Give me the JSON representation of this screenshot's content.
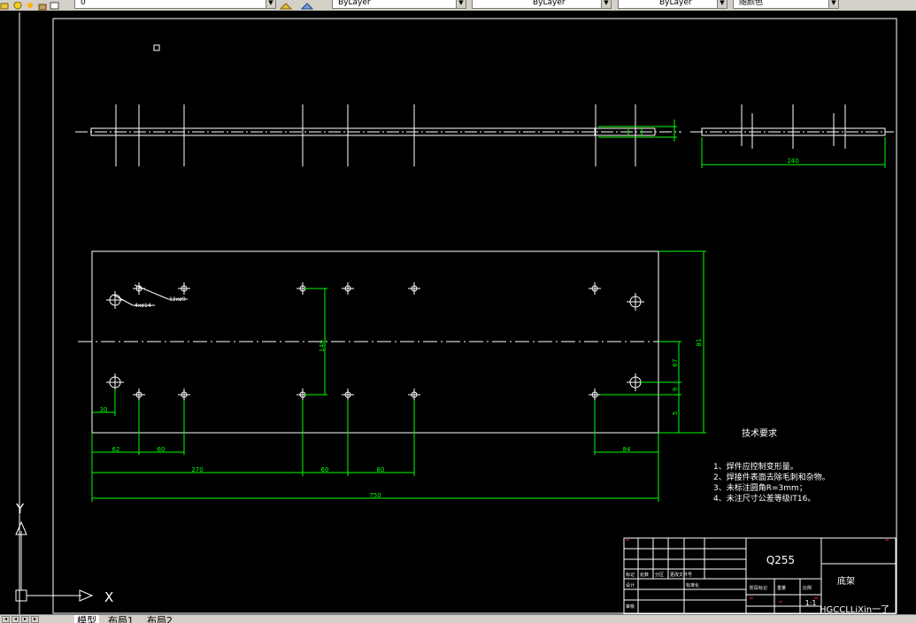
{
  "toolbar": {
    "layer_value": "0",
    "color_value": "ByLayer",
    "linetype_value": "ByLayer",
    "lineweight_value": "ByLayer",
    "plotstyle_value": "随颜色"
  },
  "layouts": {
    "tabs": [
      "模型",
      "布局1",
      "布局2"
    ]
  },
  "ucs": {
    "x_label": "X",
    "y_label": "Y"
  },
  "drawing": {
    "top_view_dims": {
      "width_label": "240"
    },
    "front_view": {
      "hole_labels": [
        "4xø14",
        "12xø9"
      ],
      "vertical_dims": [
        "140",
        "81",
        "67",
        "9",
        "5"
      ],
      "horizontal_dims": [
        "30",
        "62",
        "60",
        "270",
        "60",
        "80",
        "84",
        "750"
      ]
    },
    "tech_requirements": {
      "title": "技术要求",
      "items": [
        "1、焊件应控制变形量。",
        "2、焊接件表面去除毛刺和杂物。",
        "3、未标注圆角R=3mm；",
        "4、未注尺寸公差等级IT16。"
      ]
    },
    "title_block": {
      "material": "Q255",
      "part_name": "底架",
      "scale": "1:1",
      "row_labels": [
        "标记",
        "设计",
        "审核"
      ],
      "col_labels": [
        "处数",
        "分区",
        "更改文件号",
        "标准化",
        "阶段标记",
        "重量",
        "比例"
      ],
      "watermark": "HGCCLLiXin一了"
    }
  }
}
